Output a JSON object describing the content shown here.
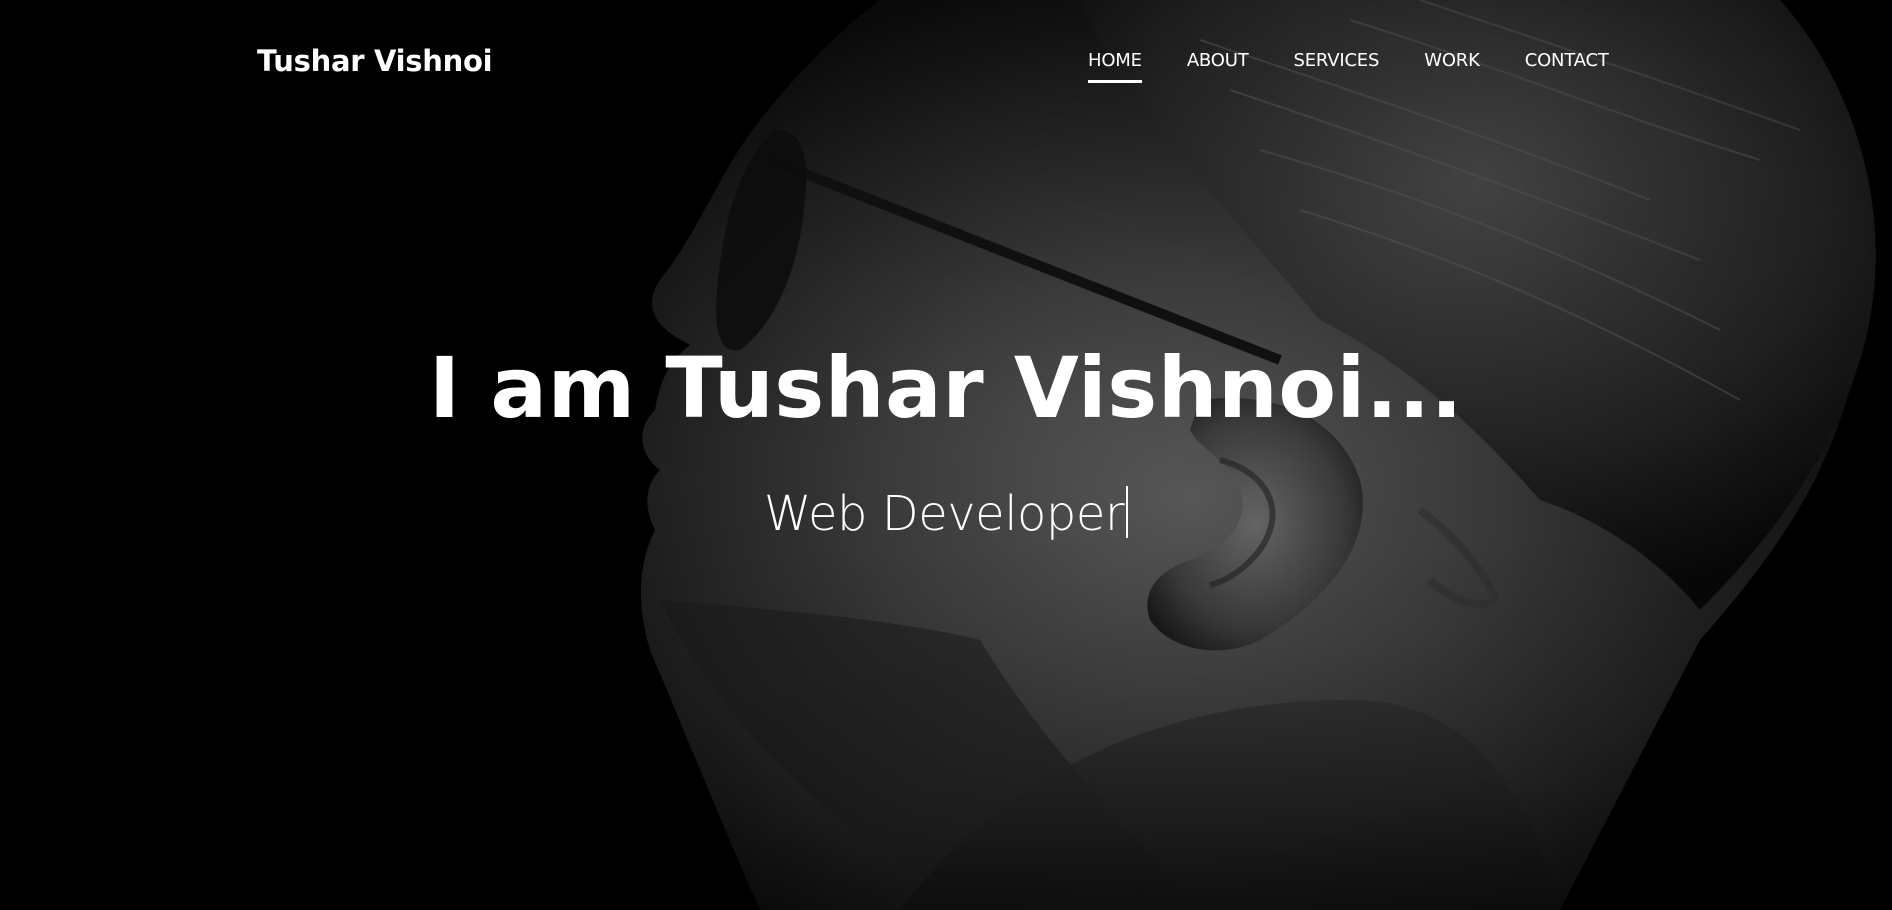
{
  "brand": {
    "name": "Tushar Vishnoi"
  },
  "nav": {
    "items": [
      {
        "label": "HOME",
        "active": true
      },
      {
        "label": "ABOUT",
        "active": false
      },
      {
        "label": "SERVICES",
        "active": false
      },
      {
        "label": "WORK",
        "active": false
      },
      {
        "label": "CONTACT",
        "active": false
      }
    ]
  },
  "hero": {
    "headline": "I am Tushar Vishnoi...",
    "subline": "Web Developer",
    "background_image": "grayscale side-profile portrait of a man wearing glasses on black background"
  },
  "colors": {
    "background": "#000000",
    "text": "#ffffff",
    "active_underline": "#ffffff"
  }
}
